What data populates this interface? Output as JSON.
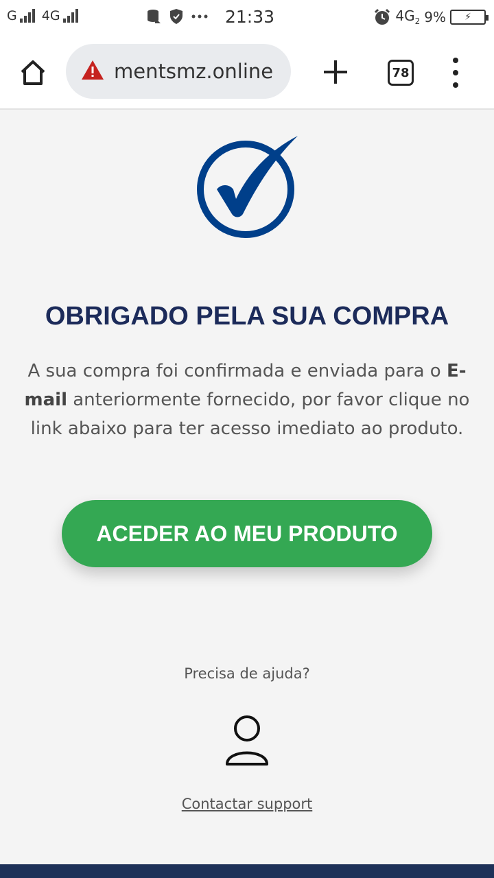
{
  "status_bar": {
    "carrier1": "G",
    "network2": "4G",
    "time": "21:33",
    "network_right": "4G",
    "network_right_sub": "2",
    "battery_percent": "9%"
  },
  "browser": {
    "url": "mentsmz.online",
    "tab_count": "78"
  },
  "page": {
    "title": "OBRIGADO PELA SUA COMPRA",
    "desc_part1": "A sua compra foi confirmada e enviada para o ",
    "desc_bold": "E-mail",
    "desc_part2": " anteriormente fornecido, por favor clique no link abaixo para ter acesso imediato ao produto.",
    "cta_label": "ACEDER AO MEU PRODUTO",
    "help_text": "Precisa de ajuda?",
    "contact_label": "Contactar support"
  },
  "colors": {
    "title": "#1c2b5a",
    "check": "#003f8a",
    "cta": "#34a853",
    "footer": "#1e3158"
  },
  "icons": [
    "home-icon",
    "warning-icon",
    "plus-icon",
    "tabs-icon",
    "more-vert-icon",
    "check-circle-icon",
    "user-icon"
  ]
}
